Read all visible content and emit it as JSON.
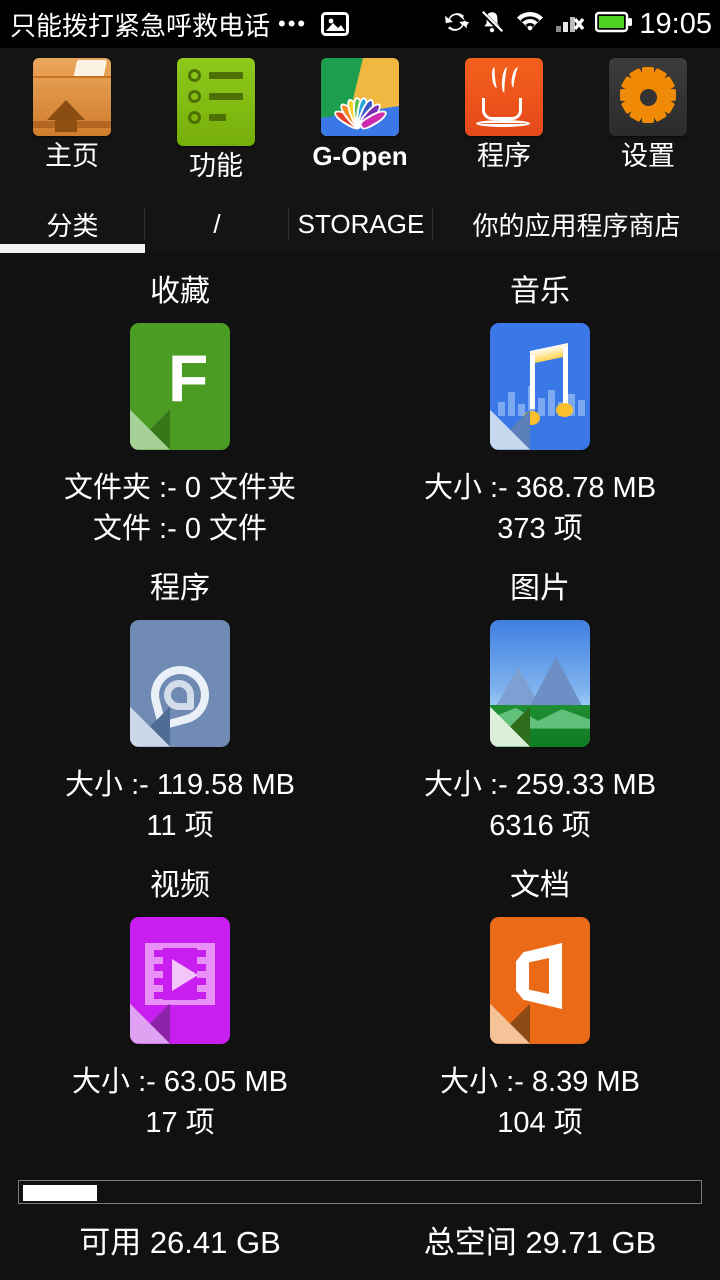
{
  "statusbar": {
    "carrier_text": "只能拨打紧急呼救电话",
    "overflow_dots": "•••",
    "icons": [
      "image-icon",
      "sync-icon",
      "bell-muted-icon",
      "wifi-icon",
      "signal-no-service-icon",
      "battery-icon"
    ],
    "clock": "19:05",
    "battery_color": "#4cd321"
  },
  "tabs": [
    {
      "label": "主页",
      "icon": "home-folder-icon"
    },
    {
      "label": "功能",
      "icon": "green-list-icon"
    },
    {
      "label": "G-Open",
      "icon": "lotus-icon"
    },
    {
      "label": "程序",
      "icon": "java-icon"
    },
    {
      "label": "设置",
      "icon": "gear-icon"
    }
  ],
  "subtabs": [
    {
      "label": "分类",
      "selected": true
    },
    {
      "label": "/",
      "selected": false
    },
    {
      "label": "STORAGE",
      "selected": false
    },
    {
      "label": "你的应用程序商店",
      "selected": false
    }
  ],
  "categories": [
    {
      "title": "收藏",
      "icon": "favorites-file-icon",
      "line1": "文件夹 :- 0 文件夹",
      "line2": "文件 :- 0 文件"
    },
    {
      "title": "音乐",
      "icon": "music-file-icon",
      "line1": "大小 :- 368.78 MB",
      "line2": "373 项"
    },
    {
      "title": "程序",
      "icon": "apps-file-icon",
      "line1": "大小 :- 119.58 MB",
      "line2": "11 项"
    },
    {
      "title": "图片",
      "icon": "images-file-icon",
      "line1": "大小 :- 259.33 MB",
      "line2": "6316 项"
    },
    {
      "title": "视频",
      "icon": "video-file-icon",
      "line1": "大小 :- 63.05 MB",
      "line2": "17 项"
    },
    {
      "title": "文档",
      "icon": "documents-file-icon",
      "line1": "大小 :- 8.39 MB",
      "line2": "104 项"
    }
  ],
  "storage": {
    "free_label": "可用 26.41 GB",
    "total_label": "总空间 29.71 GB",
    "used_percent": 11
  }
}
